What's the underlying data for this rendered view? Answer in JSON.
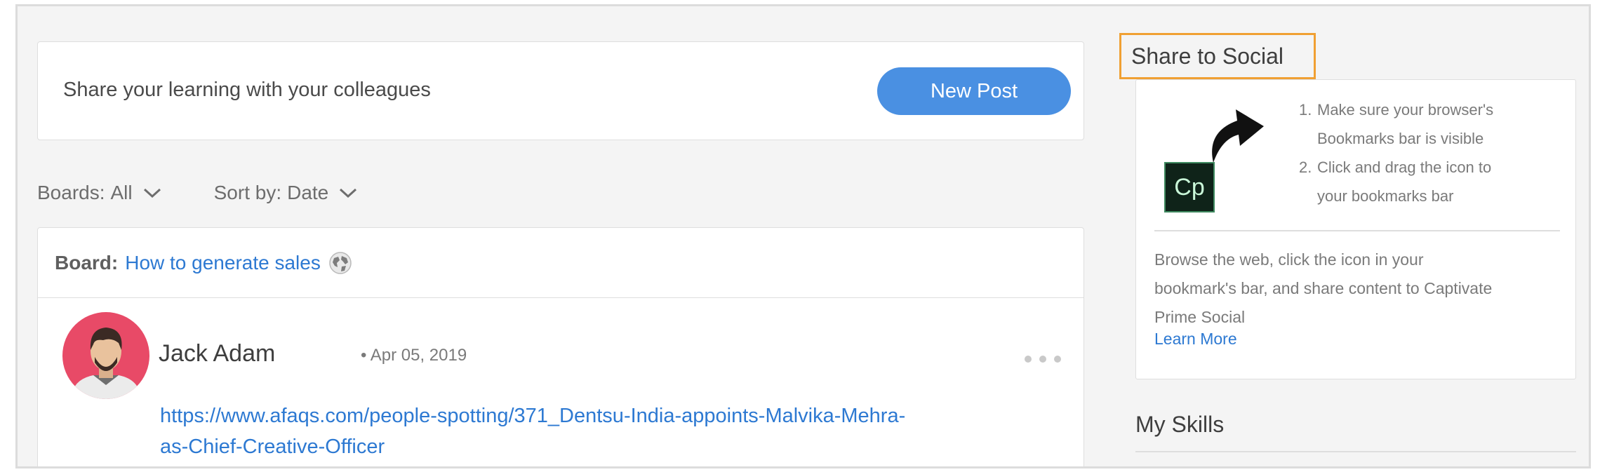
{
  "share_card": {
    "prompt": "Share your learning with your colleagues",
    "new_post_label": "New Post"
  },
  "filters": {
    "boards_label": "Boards:",
    "boards_value": "All",
    "sort_label": "Sort by:",
    "sort_value": "Date"
  },
  "board": {
    "prefix": "Board:",
    "name": "How to generate sales"
  },
  "post": {
    "author": "Jack Adam",
    "date": "Apr 05, 2019",
    "link_line1": "https://www.afaqs.com/people-spotting/371_Dentsu-India-appoints-Malvika-Mehra-",
    "link_line2": "as-Chief-Creative-Officer"
  },
  "share_social": {
    "title": "Share to Social",
    "cp_label": "Cp",
    "steps": [
      {
        "num": "1.",
        "lines": [
          "Make sure your browser's",
          "Bookmarks bar is visible"
        ]
      },
      {
        "num": "2.",
        "lines": [
          "Click and drag the icon to",
          "your bookmarks bar"
        ]
      }
    ],
    "browse_lines": [
      "Browse the web, click the icon in your",
      "bookmark's bar, and share content to Captivate",
      "Prime Social"
    ],
    "learn_more": "Learn More"
  },
  "my_skills": {
    "title": "My Skills"
  },
  "colors": {
    "accent_blue": "#4a90e2",
    "link_blue": "#2d79d2",
    "highlight_orange": "#f0a033",
    "background": "#f4f4f4",
    "avatar_red": "#e84a67"
  },
  "icons": [
    "chevron-down-icon",
    "globe-icon",
    "avatar",
    "more-options-icon",
    "curved-arrow-icon",
    "captivate-cp-icon"
  ]
}
